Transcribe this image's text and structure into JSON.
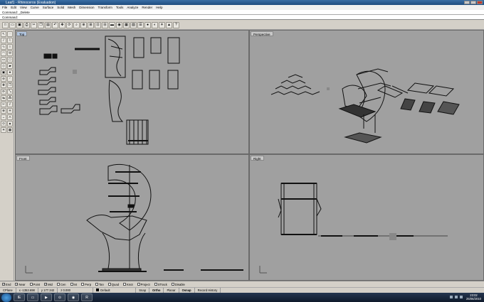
{
  "window": {
    "title": "Leaf1 - Rhinoceros (Evaluation)"
  },
  "menu": [
    "File",
    "Edit",
    "View",
    "Curve",
    "Surface",
    "Solid",
    "Mesh",
    "Dimension",
    "Transform",
    "Tools",
    "Analyze",
    "Render",
    "Help"
  ],
  "command": {
    "history": "Command: _Delete",
    "prompt": "Command:"
  },
  "toolbar": {
    "icons": [
      "new-icon",
      "open-icon",
      "save-icon",
      "print-icon",
      "cut-icon",
      "copy-icon",
      "paste-icon",
      "undo-icon",
      "pan-icon",
      "rotate-view-icon",
      "zoom-icon",
      "zoom-window-icon",
      "zoom-extents-icon",
      "zoom-selected-icon",
      "four-viewports-icon",
      "car-icon",
      "camera-icon",
      "grid-icon",
      "layer-icon",
      "object-properties-icon",
      "shaded-icon",
      "rendered-icon",
      "light-icon",
      "render-icon",
      "help-icon"
    ],
    "glyphs": [
      "□",
      "▭",
      "▣",
      "⎙",
      "✂",
      "❐",
      "▤",
      "↶",
      "✥",
      "⟳",
      "⌕",
      "⊕",
      "⊞",
      "⊡",
      "⊟",
      "▬",
      "◉",
      "▦",
      "▧",
      "☰",
      "●",
      "◐",
      "☀",
      "▲",
      "?"
    ]
  },
  "sidebar": {
    "icons": [
      "select-icon",
      "point-icon",
      "line-icon",
      "polyline-icon",
      "curve-icon",
      "circle-icon",
      "arc-icon",
      "ellipse-icon",
      "rectangle-icon",
      "polygon-icon",
      "surface-icon",
      "extrude-icon",
      "box-icon",
      "sphere-icon",
      "boolean-icon",
      "fillet-icon",
      "move-icon",
      "copy-icon",
      "rotate-icon",
      "scale-icon",
      "mirror-icon",
      "array-icon",
      "trim-icon",
      "split-icon",
      "join-icon",
      "explode-icon",
      "dimension-icon",
      "text-icon",
      "analyze-icon",
      "render-icon",
      "light-icon",
      "mesh-icon"
    ],
    "glyphs": [
      "↖",
      "·",
      "/",
      "⌇",
      "∿",
      "○",
      "◠",
      "⬭",
      "▭",
      "⬡",
      "◇",
      "▰",
      "▣",
      "●",
      "⊖",
      "◜",
      "✥",
      "❐",
      "⟳",
      "⤡",
      "⇋",
      "⁂",
      "✂",
      "⫽",
      "⊕",
      "✳",
      "↔",
      "A",
      "⊙",
      "▲",
      "☀",
      "▦"
    ]
  },
  "viewports": [
    {
      "id": "top",
      "label": "Top"
    },
    {
      "id": "perspective",
      "label": "Perspective"
    },
    {
      "id": "front",
      "label": "Front"
    },
    {
      "id": "right",
      "label": "Right"
    }
  ],
  "osnap": [
    {
      "label": "End",
      "checked": true
    },
    {
      "label": "Near",
      "checked": true
    },
    {
      "label": "Point",
      "checked": false
    },
    {
      "label": "Mid",
      "checked": true
    },
    {
      "label": "Cen",
      "checked": false
    },
    {
      "label": "Int",
      "checked": false
    },
    {
      "label": "Perp",
      "checked": false
    },
    {
      "label": "Tan",
      "checked": false
    },
    {
      "label": "Quad",
      "checked": false
    },
    {
      "label": "Knot",
      "checked": false
    },
    {
      "label": "Project",
      "checked": false
    },
    {
      "label": "STrack",
      "checked": false
    },
    {
      "label": "Disable",
      "checked": false
    }
  ],
  "status": {
    "cplane": "CPlane",
    "x": "x -1353.698",
    "y": "y 177.342",
    "z": "z 0.000",
    "layer": "Default",
    "snap": "Snap",
    "ortho": "Ortho",
    "planar": "Planar",
    "osnap": "Osnap",
    "record": "Record History"
  },
  "taskbar": {
    "time": "23:02",
    "date": "25/06/2010",
    "apps": [
      "IE",
      "▭",
      "▶",
      "⊙",
      "◉",
      "R"
    ]
  },
  "colors": {
    "viewport_bg": "#a0a0a0",
    "title_blue": "#1f4d7f"
  }
}
